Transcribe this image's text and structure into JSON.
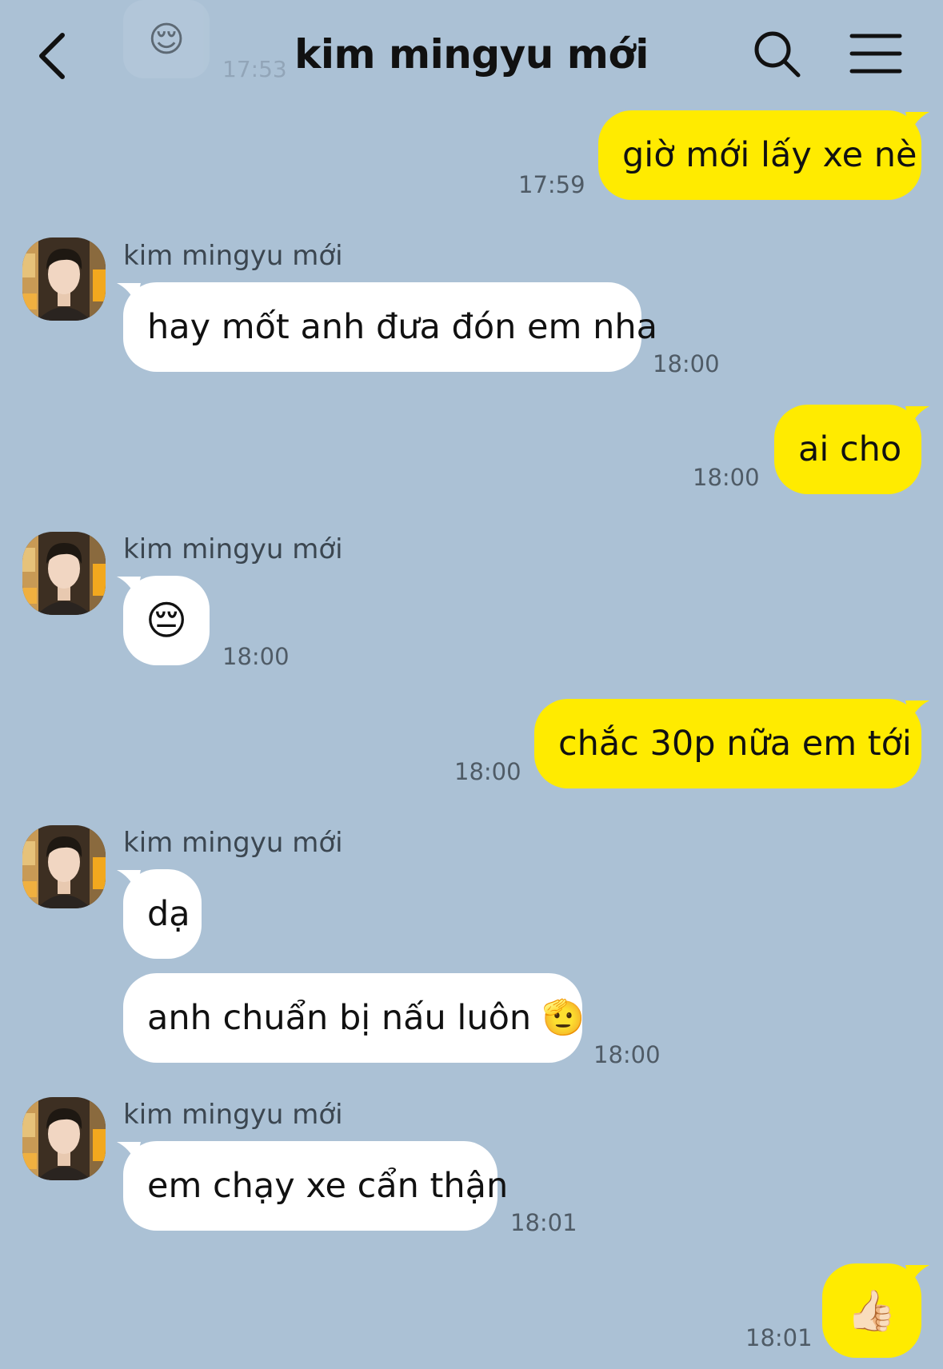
{
  "header": {
    "title": "kim mingyu mới",
    "back_icon": "chevron-left-icon",
    "search_icon": "search-icon",
    "menu_icon": "hamburger-menu-icon"
  },
  "faded_previous": {
    "emoji": "😌",
    "time": "17:53"
  },
  "messages": [
    {
      "from": "me",
      "text": "giờ mới lấy xe nè",
      "time": "17:59"
    },
    {
      "from": "them",
      "sender": "kim mingyu mới",
      "text": "hay mốt anh đưa đón em nha",
      "time": "18:00"
    },
    {
      "from": "me",
      "text": "ai cho",
      "time": "18:00"
    },
    {
      "from": "them",
      "sender": "kim mingyu mới",
      "text": "😔",
      "time": "18:00"
    },
    {
      "from": "me",
      "text": "chắc 30p nữa em tới",
      "time": "18:00"
    },
    {
      "from": "them",
      "sender": "kim mingyu mới",
      "text": "dạ"
    },
    {
      "from": "them",
      "text": "anh chuẩn bị nấu luôn 🫡",
      "time": "18:00"
    },
    {
      "from": "them",
      "sender": "kim mingyu mới",
      "text": "em chạy xe cẩn thận",
      "time": "18:01"
    },
    {
      "from": "me",
      "text": "👍🏻",
      "time": "18:01"
    }
  ],
  "colors": {
    "background": "#abc1d5",
    "outgoing_bubble": "#ffeb00",
    "incoming_bubble": "#ffffff"
  }
}
